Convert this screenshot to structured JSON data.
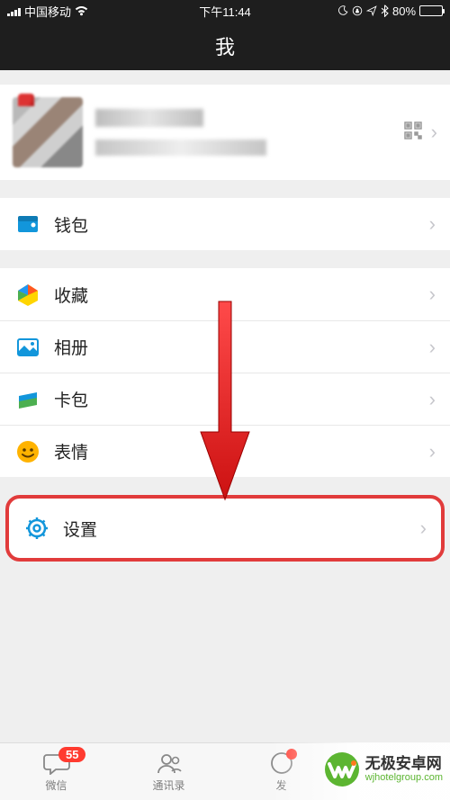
{
  "status": {
    "carrier": "中国移动",
    "time": "下午11:44",
    "battery_pct": "80%",
    "battery_fill": 80
  },
  "nav": {
    "title": "我"
  },
  "menu": {
    "wallet": "钱包",
    "favorites": "收藏",
    "album": "相册",
    "cards": "卡包",
    "stickers": "表情",
    "settings": "设置"
  },
  "tabs": {
    "chats": "微信",
    "contacts": "通讯录",
    "discover": "发",
    "chats_badge": "55"
  },
  "watermark": {
    "title": "无极安卓网",
    "url": "wjhotelgroup.com"
  }
}
